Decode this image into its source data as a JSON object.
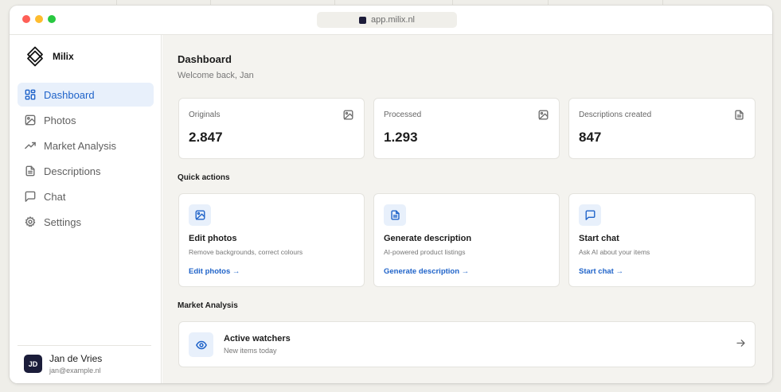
{
  "browser": {
    "url": "app.milix.nl"
  },
  "brand": {
    "name": "Milix"
  },
  "sidebar": {
    "items": [
      {
        "label": "Dashboard",
        "icon": "dashboard-icon",
        "active": true
      },
      {
        "label": "Photos",
        "icon": "image-icon",
        "active": false
      },
      {
        "label": "Market Analysis",
        "icon": "trend-icon",
        "active": false
      },
      {
        "label": "Descriptions",
        "icon": "document-icon",
        "active": false
      },
      {
        "label": "Chat",
        "icon": "chat-icon",
        "active": false
      },
      {
        "label": "Settings",
        "icon": "gear-icon",
        "active": false
      }
    ]
  },
  "user": {
    "initials": "JD",
    "name": "Jan de Vries",
    "email": "jan@example.nl"
  },
  "page": {
    "title": "Dashboard",
    "welcome": "Welcome back, Jan"
  },
  "stats": [
    {
      "label": "Originals",
      "value": "2.847",
      "icon": "image-icon"
    },
    {
      "label": "Processed",
      "value": "1.293",
      "icon": "image-icon"
    },
    {
      "label": "Descriptions created",
      "value": "847",
      "icon": "document-icon"
    }
  ],
  "quick_actions": {
    "title": "Quick actions",
    "items": [
      {
        "title": "Edit photos",
        "desc": "Remove backgrounds, correct colours",
        "link": "Edit photos →",
        "icon": "image-icon"
      },
      {
        "title": "Generate description",
        "desc": "AI-powered product listings",
        "link": "Generate description →",
        "icon": "document-icon"
      },
      {
        "title": "Start chat",
        "desc": "Ask AI about your items",
        "link": "Start chat →",
        "icon": "chat-icon"
      }
    ]
  },
  "market": {
    "title": "Market Analysis",
    "watchers_title": "Active watchers",
    "watchers_sub": "New items today"
  },
  "colors": {
    "accent": "#1f63c9",
    "accent_bg": "#e8f0fb",
    "avatar_bg": "#1b1d3a"
  }
}
